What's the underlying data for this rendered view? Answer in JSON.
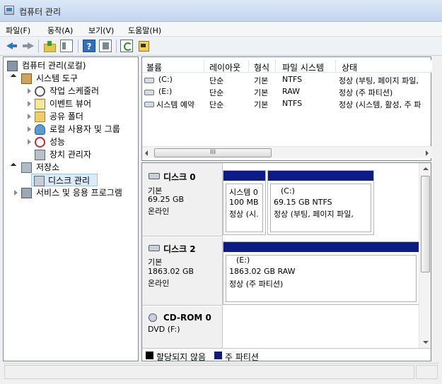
{
  "window": {
    "title": "컴퓨터 관리"
  },
  "menu": [
    {
      "label": "파일(F)"
    },
    {
      "label": "동작(A)"
    },
    {
      "label": "보기(V)"
    },
    {
      "label": "도움말(H)"
    }
  ],
  "toolbar": {
    "help_label": "?"
  },
  "tree": {
    "root": "컴퓨터 관리(로컬)",
    "system_tools": "시스템 도구",
    "task_scheduler": "작업 스케줄러",
    "event_viewer": "이벤트 뷰어",
    "shared_folders": "공유 폴더",
    "local_users": "로컬 사용자 및 그룹",
    "performance": "성능",
    "device_manager": "장치 관리자",
    "storage": "저장소",
    "disk_management": "디스크 관리",
    "services": "서비스 및 응용 프로그램"
  },
  "volume_list": {
    "columns": [
      "볼륨",
      "레이아웃",
      "형식",
      "파일 시스템",
      "상태"
    ],
    "rows": [
      {
        "volume": "(C:)",
        "layout": "단순",
        "type": "기본",
        "fs": "NTFS",
        "status": "정상 (부팅, 페이지 파일,"
      },
      {
        "volume": "(E:)",
        "layout": "단순",
        "type": "기본",
        "fs": "RAW",
        "status": "정상 (주 파티션)"
      },
      {
        "volume": "시스템 예약",
        "layout": "단순",
        "type": "기본",
        "fs": "NTFS",
        "status": "정상 (시스템, 활성, 주 파"
      }
    ],
    "scroll_thumb_label": "III"
  },
  "disks": [
    {
      "name": "디스크 0",
      "kind": "기본",
      "size": "69.25 GB",
      "state": "온라인",
      "partitions": [
        {
          "line1": "시스템 0",
          "line2": "100 MB",
          "line3": "정상 (시."
        },
        {
          "line1": "(C:)",
          "line2": "69.15 GB NTFS",
          "line3": "정상 (부팅, 페이지 파일,"
        }
      ]
    },
    {
      "name": "디스크 2",
      "kind": "기본",
      "size": "1863.02 GB",
      "state": "온라인",
      "partitions": [
        {
          "line1": "(E:)",
          "line2": "1863.02 GB RAW",
          "line3": "정상 (주 파티션)"
        }
      ]
    },
    {
      "name": "CD-ROM 0",
      "kind": "DVD (F:)"
    }
  ],
  "legend": {
    "unallocated": "할당되지 않음",
    "primary": "주 파티션"
  },
  "colors": {
    "primary_partition": "#0d1b86",
    "unallocated": "#000000"
  }
}
